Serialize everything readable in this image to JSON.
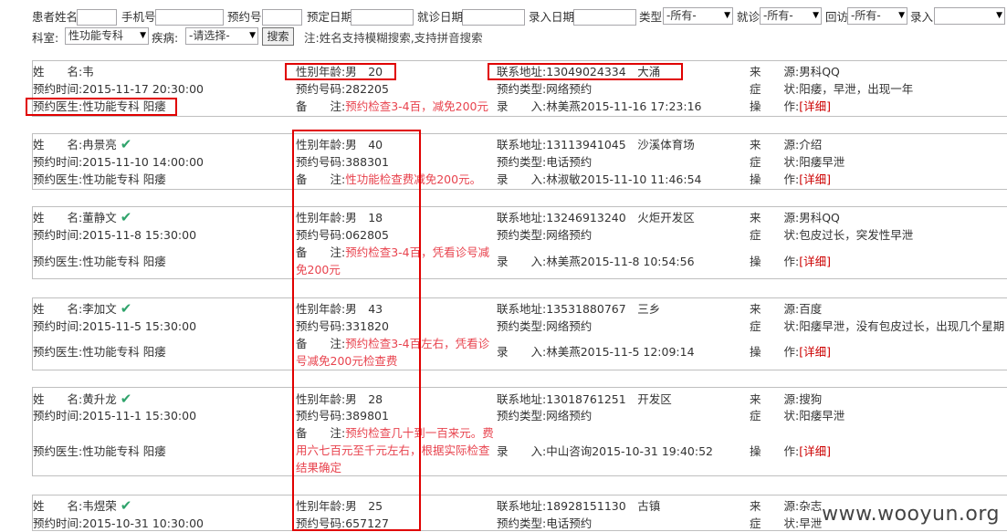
{
  "filters": {
    "name_label": "患者姓名",
    "phone_label": "手机号",
    "booking_no_label": "预约号",
    "scheduled_date_label": "预定日期",
    "visit_date_label": "就诊日期",
    "entry_date_label": "录入日期",
    "type_label": "类型",
    "type_value": "-所有-",
    "visit_label": "就诊",
    "visit_value": "-所有-",
    "revisit_label": "回访",
    "revisit_value": "-所有-",
    "entry_label": "录入",
    "entry_value": "",
    "dept_label": "科室:",
    "dept_value": "性功能专科",
    "disease_label": "疾病:",
    "disease_value": "-请选择-",
    "search_button": "搜索",
    "note": "注:姓名支持模糊搜索,支持拼音搜索"
  },
  "labels": {
    "name": "姓　　名:",
    "time": "预约时间:",
    "doctor": "预约医生:",
    "gender_age": "性别年龄:",
    "booking_no": "预约号码:",
    "remark": "备　　注:",
    "contact": "联系地址:",
    "booking_type": "预约类型:",
    "entry": "录　　入:",
    "source": "来　　源:",
    "symptom": "症　　状:",
    "action": "操　　作:",
    "detail": "[详细]"
  },
  "records": [
    {
      "name": "韦",
      "time": "2015-11-17 20:30:00",
      "doctor": "性功能专科 阳痿",
      "gender_age": "男　20",
      "booking_no": "282205",
      "remark": "预约检查3-4百，减免200元",
      "contact": "13049024334　大涌",
      "booking_type": "网络预约",
      "entry": "林美燕2015-11-16 17:23:16",
      "source": "男科QQ",
      "symptom": "阳痿，早泄，出现一年"
    },
    {
      "name": "冉景亮",
      "time": "2015-11-10 14:00:00",
      "doctor": "性功能专科 阳痿",
      "gender_age": "男　40",
      "booking_no": "388301",
      "remark": "性功能检查费减免200元。",
      "contact": "13113941045　沙溪体育场",
      "booking_type": "电话预约",
      "entry": "林淑敏2015-11-10 11:46:54",
      "source": "介绍",
      "symptom": "阳痿早泄"
    },
    {
      "name": "董静文",
      "time": "2015-11-8 15:30:00",
      "doctor": "性功能专科 阳痿",
      "gender_age": "男　18",
      "booking_no": "062805",
      "remark": "预约检查3-4百，凭看诊号减免200元",
      "contact": "13246913240　火炬开发区",
      "booking_type": "网络预约",
      "entry": "林美燕2015-11-8 10:54:56",
      "source": "男科QQ",
      "symptom": "包皮过长，突发性早泄"
    },
    {
      "name": "李加文",
      "time": "2015-11-5 15:30:00",
      "doctor": "性功能专科 阳痿",
      "gender_age": "男　43",
      "booking_no": "331820",
      "remark": "预约检查3-4百左右，凭看诊号减免200元检查费",
      "contact": "13531880767　三乡",
      "booking_type": "网络预约",
      "entry": "林美燕2015-11-5 12:09:14",
      "source": "百度",
      "symptom": "阳痿早泄，没有包皮过长，出现几个星期"
    },
    {
      "name": "黄升龙",
      "time": "2015-11-1 15:30:00",
      "doctor": "性功能专科 阳痿",
      "gender_age": "男　28",
      "booking_no": "389801",
      "remark": "预约检查几十到一百来元。费用六七百元至千元左右，根据实际检查结果确定",
      "contact": "13018761251　开发区",
      "booking_type": "网络预约",
      "entry": "中山咨询2015-10-31 19:40:52",
      "source": "搜狗",
      "symptom": "阳痿早泄"
    },
    {
      "name": "韦煜荣",
      "time": "2015-10-31 10:30:00",
      "doctor": "",
      "gender_age": "男　25",
      "booking_no": "657127",
      "remark": "",
      "contact": "18928151130　古镇",
      "booking_type": "电话预约",
      "entry": "",
      "source": "杂志",
      "symptom": "早泄"
    }
  ],
  "watermark": "www.wooyun.org"
}
